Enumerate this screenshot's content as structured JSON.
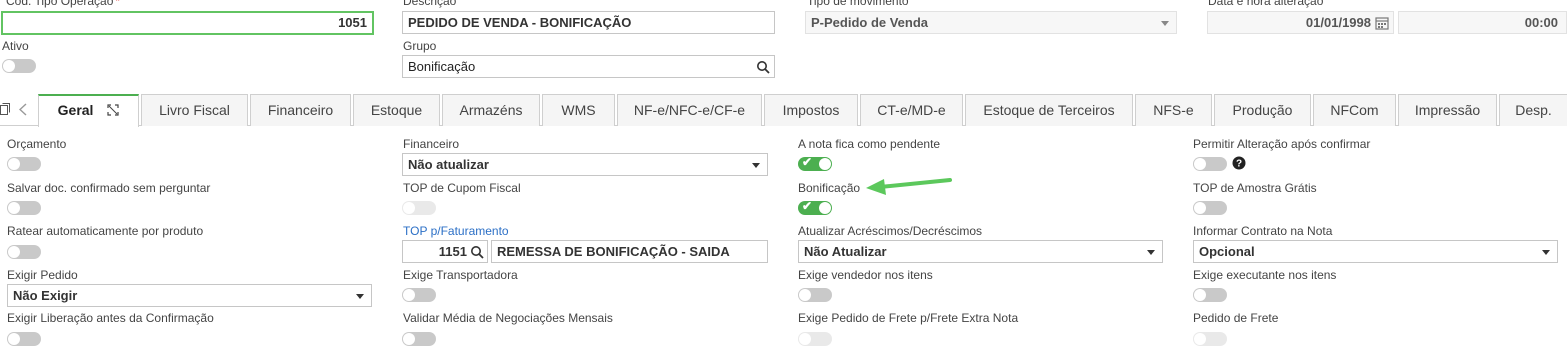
{
  "header": {
    "cod_tipo_operacao": {
      "label": "Cód. Tipo Operação",
      "required": "*",
      "value": "1051"
    },
    "descricao": {
      "label": "Descrição",
      "value": "PEDIDO DE VENDA - BONIFICAÇÃO"
    },
    "tipo_movimento": {
      "label": "Tipo de movimento",
      "value": "P-Pedido de Venda"
    },
    "data_hora": {
      "label": "Data e hora alteração",
      "date": "01/01/1998",
      "time": "00:00"
    },
    "ativo": {
      "label": "Ativo",
      "state": "off"
    },
    "grupo": {
      "label": "Grupo",
      "value": "Bonificação"
    }
  },
  "tabs": [
    {
      "label": "Geral",
      "active": true
    },
    {
      "label": "Livro Fiscal"
    },
    {
      "label": "Financeiro"
    },
    {
      "label": "Estoque"
    },
    {
      "label": "Armazéns"
    },
    {
      "label": "WMS"
    },
    {
      "label": "NF-e/NFC-e/CF-e"
    },
    {
      "label": "Impostos"
    },
    {
      "label": "CT-e/MD-e"
    },
    {
      "label": "Estoque de Terceiros"
    },
    {
      "label": "NFS-e"
    },
    {
      "label": "Produção"
    },
    {
      "label": "NFCom"
    },
    {
      "label": "Impressão"
    },
    {
      "label": "Desp."
    }
  ],
  "col1": {
    "orcamento": {
      "label": "Orçamento",
      "state": "off"
    },
    "salvar_doc": {
      "label": "Salvar doc. confirmado sem perguntar",
      "state": "off"
    },
    "ratear": {
      "label": "Ratear automaticamente por produto",
      "state": "off"
    },
    "exigir_pedido": {
      "label": "Exigir Pedido",
      "value": "Não Exigir"
    },
    "exigir_liberacao": {
      "label": "Exigir Liberação antes da Confirmação",
      "state": "off"
    }
  },
  "col2": {
    "financeiro": {
      "label": "Financeiro",
      "value": "Não atualizar"
    },
    "top_cupom": {
      "label": "TOP de Cupom Fiscal",
      "state": "disabled"
    },
    "top_faturamento": {
      "label": "TOP p/Faturamento",
      "code": "1151",
      "description": "REMESSA DE BONIFICAÇÃO - SAIDA"
    },
    "exige_transportadora": {
      "label": "Exige Transportadora",
      "state": "off"
    },
    "validar_media": {
      "label": "Validar Média de Negociações Mensais",
      "state": "off"
    }
  },
  "col3": {
    "nota_pendente": {
      "label": "A nota fica como pendente",
      "state": "on"
    },
    "bonificacao": {
      "label": "Bonificação",
      "state": "on"
    },
    "atualizar_acrescimos": {
      "label": "Atualizar Acréscimos/Decréscimos",
      "value": "Não Atualizar"
    },
    "exige_vendedor": {
      "label": "Exige vendedor nos itens",
      "state": "off"
    },
    "exige_pedido_frete": {
      "label": "Exige Pedido de Frete p/Frete Extra Nota",
      "state": "disabled"
    }
  },
  "col4": {
    "permitir_alteracao": {
      "label": "Permitir Alteração após confirmar",
      "state": "off"
    },
    "top_amostra": {
      "label": "TOP de Amostra Grátis",
      "state": "off"
    },
    "informar_contrato": {
      "label": "Informar Contrato na Nota",
      "value": "Opcional"
    },
    "exige_executante": {
      "label": "Exige executante nos itens",
      "state": "off"
    },
    "pedido_frete": {
      "label": "Pedido de Frete",
      "state": "disabled"
    }
  },
  "colors": {
    "accent": "#4caf50",
    "arrow": "#5cc85c",
    "link": "#2b6fc6",
    "required": "#e53935"
  }
}
